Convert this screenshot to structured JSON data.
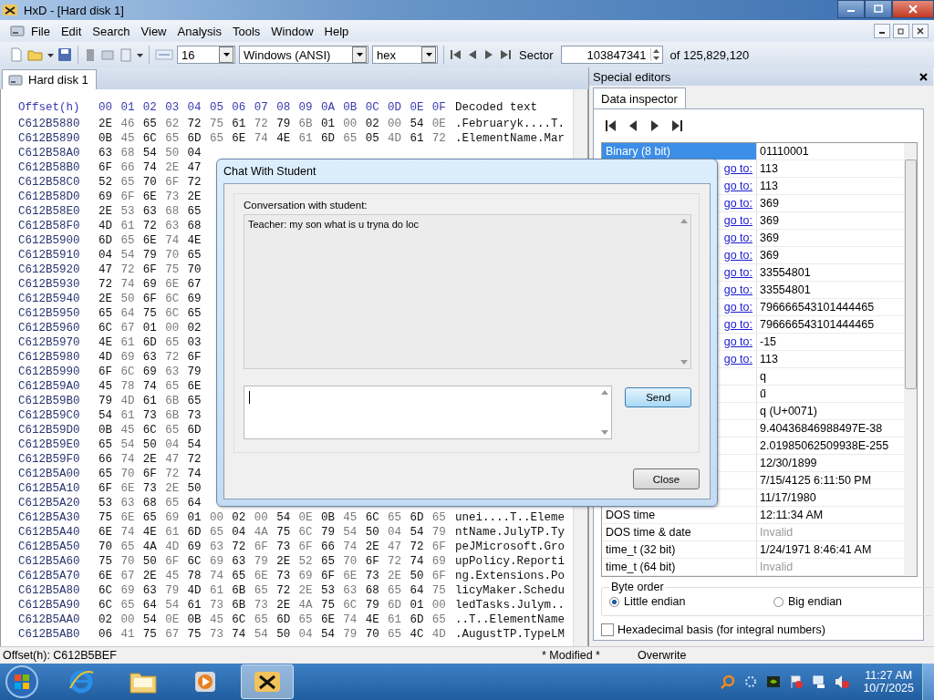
{
  "window": {
    "title": "HxD - [Hard disk 1]"
  },
  "menu": [
    "File",
    "Edit",
    "Search",
    "View",
    "Analysis",
    "Tools",
    "Window",
    "Help"
  ],
  "toolbar": {
    "bytes_per_row": "16",
    "charset": "Windows (ANSI)",
    "display": "hex",
    "sector_label": "Sector",
    "sector": "103847341",
    "sector_total": "of 125,829,120"
  },
  "document_tabs": [
    {
      "label": "Hard disk 1",
      "selected": true
    }
  ],
  "hex_view": {
    "header": {
      "offset": "Offset(h)",
      "columns": "00 01 02 03 04 05 06 07 08 09 0A 0B 0C 0D 0E 0F",
      "decoded": "Decoded text"
    },
    "rows": [
      {
        "offset": "C612B5880",
        "bytes": "2E 46 65 62 72 75 61 72 79 6B 01 00 02 00 54 0E",
        "text": ".Februaryk....T."
      },
      {
        "offset": "C612B5890",
        "bytes": "0B 45 6C 65 6D 65 6E 74 4E 61 6D 65 05 4D 61 72",
        "text": ".ElementName.Mar"
      },
      {
        "offset": "C612B58A0",
        "bytes": "63 68 54 50 04"
      },
      {
        "offset": "C612B58B0",
        "bytes": "6F 66 74 2E 47"
      },
      {
        "offset": "C612B58C0",
        "bytes": "52 65 70 6F 72"
      },
      {
        "offset": "C612B58D0",
        "bytes": "69 6F 6E 73 2E"
      },
      {
        "offset": "C612B58E0",
        "bytes": "2E 53 63 68 65"
      },
      {
        "offset": "C612B58F0",
        "bytes": "4D 61 72 63 68"
      },
      {
        "offset": "C612B5900",
        "bytes": "6D 65 6E 74 4E"
      },
      {
        "offset": "C612B5910",
        "bytes": "04 54 79 70 65"
      },
      {
        "offset": "C612B5920",
        "bytes": "47 72 6F 75 70"
      },
      {
        "offset": "C612B5930",
        "bytes": "72 74 69 6E 67"
      },
      {
        "offset": "C612B5940",
        "bytes": "2E 50 6F 6C 69"
      },
      {
        "offset": "C612B5950",
        "bytes": "65 64 75 6C 65"
      },
      {
        "offset": "C612B5960",
        "bytes": "6C 67 01 00 02"
      },
      {
        "offset": "C612B5970",
        "bytes": "4E 61 6D 65 03"
      },
      {
        "offset": "C612B5980",
        "bytes": "4D 69 63 72 6F"
      },
      {
        "offset": "C612B5990",
        "bytes": "6F 6C 69 63 79"
      },
      {
        "offset": "C612B59A0",
        "bytes": "45 78 74 65 6E"
      },
      {
        "offset": "C612B59B0",
        "bytes": "79 4D 61 6B 65"
      },
      {
        "offset": "C612B59C0",
        "bytes": "54 61 73 6B 73"
      },
      {
        "offset": "C612B59D0",
        "bytes": "0B 45 6C 65 6D"
      },
      {
        "offset": "C612B59E0",
        "bytes": "65 54 50 04 54"
      },
      {
        "offset": "C612B59F0",
        "bytes": "66 74 2E 47 72"
      },
      {
        "offset": "C612B5A00",
        "bytes": "65 70 6F 72 74"
      },
      {
        "offset": "C612B5A10",
        "bytes": "6F 6E 73 2E 50"
      },
      {
        "offset": "C612B5A20",
        "bytes": "53 63 68 65 64"
      },
      {
        "offset": "C612B5A30",
        "bytes": "75 6E 65 69 01 00 02 00 54 0E 0B 45 6C 65 6D 65",
        "text": "unei....T..Eleme"
      },
      {
        "offset": "C612B5A40",
        "bytes": "6E 74 4E 61 6D 65 04 4A 75 6C 79 54 50 04 54 79",
        "text": "ntName.JulyTP.Ty"
      },
      {
        "offset": "C612B5A50",
        "bytes": "70 65 4A 4D 69 63 72 6F 73 6F 66 74 2E 47 72 6F",
        "text": "peJMicrosoft.Gro"
      },
      {
        "offset": "C612B5A60",
        "bytes": "75 70 50 6F 6C 69 63 79 2E 52 65 70 6F 72 74 69",
        "text": "upPolicy.Reporti"
      },
      {
        "offset": "C612B5A70",
        "bytes": "6E 67 2E 45 78 74 65 6E 73 69 6F 6E 73 2E 50 6F",
        "text": "ng.Extensions.Po"
      },
      {
        "offset": "C612B5A80",
        "bytes": "6C 69 63 79 4D 61 6B 65 72 2E 53 63 68 65 64 75",
        "text": "licyMaker.Schedu"
      },
      {
        "offset": "C612B5A90",
        "bytes": "6C 65 64 54 61 73 6B 73 2E 4A 75 6C 79 6D 01 00",
        "text": "ledTasks.Julym.."
      },
      {
        "offset": "C612B5AA0",
        "bytes": "02 00 54 0E 0B 45 6C 65 6D 65 6E 74 4E 61 6D 65",
        "text": "..T..ElementName"
      },
      {
        "offset": "C612B5AB0",
        "bytes": "06 41 75 67 75 73 74 54 50 04 54 79 70 65 4C 4D",
        "text": ".AugustTP.TypeLM"
      }
    ]
  },
  "special_editors": {
    "title": "Special editors",
    "tabs": [
      {
        "label": "Data inspector",
        "selected": true
      }
    ],
    "rows": [
      {
        "label": "Binary (8 bit)",
        "value": "01110001",
        "selected": true,
        "invalid": false
      },
      {
        "link": "go to:",
        "value": "113",
        "selected": false,
        "invalid": false
      },
      {
        "link": "go to:",
        "value": "113",
        "selected": false,
        "invalid": false
      },
      {
        "link": "go to:",
        "value": "369",
        "selected": false,
        "invalid": false
      },
      {
        "link": "go to:",
        "value": "369",
        "selected": false,
        "invalid": false
      },
      {
        "link": "go to:",
        "value": "369",
        "selected": false,
        "invalid": false
      },
      {
        "link": "go to:",
        "value": "369",
        "selected": false,
        "invalid": false
      },
      {
        "link": "go to:",
        "value": "33554801",
        "selected": false,
        "invalid": false
      },
      {
        "link": "go to:",
        "value": "33554801",
        "selected": false,
        "invalid": false
      },
      {
        "link": "go to:",
        "value": "796666543101444465",
        "selected": false,
        "invalid": false
      },
      {
        "link": "go to:",
        "value": "796666543101444465",
        "selected": false,
        "invalid": false
      },
      {
        "link": "go to:",
        "value": "-15",
        "selected": false,
        "invalid": false
      },
      {
        "link": "go to:",
        "value": "113",
        "selected": false,
        "invalid": false
      },
      {
        "value": "q",
        "selected": false,
        "invalid": false
      },
      {
        "value": "ű",
        "selected": false,
        "invalid": false
      },
      {
        "value": "q (U+0071)",
        "selected": false,
        "invalid": false
      },
      {
        "value": "9.40436846988497E-38",
        "selected": false,
        "invalid": false
      },
      {
        "value": "2.01985062509938E-255",
        "selected": false,
        "invalid": false
      },
      {
        "value": "12/30/1899",
        "selected": false,
        "invalid": false
      },
      {
        "value": "7/15/4125 6:11:50 PM",
        "selected": false,
        "invalid": false
      },
      {
        "value": "11/17/1980",
        "selected": false,
        "invalid": false
      },
      {
        "label": "DOS time",
        "value": "12:11:34 AM",
        "selected": false,
        "invalid": false
      },
      {
        "label": "DOS time & date",
        "value": "Invalid",
        "selected": false,
        "invalid": true
      },
      {
        "label": "time_t (32 bit)",
        "value": "1/24/1971 8:46:41 AM",
        "selected": false,
        "invalid": false
      },
      {
        "label": "time_t (64 bit)",
        "value": "Invalid",
        "selected": false,
        "invalid": true
      }
    ],
    "byte_order": {
      "title": "Byte order",
      "options": [
        {
          "label": "Little endian",
          "selected": true
        },
        {
          "label": "Big endian",
          "selected": false
        }
      ]
    },
    "hex_basis": {
      "label": "Hexadecimal basis (for integral numbers)",
      "checked": false
    }
  },
  "dialog": {
    "title": "Chat With Student",
    "group": "Conversation with student:",
    "conversation": "Teacher: my son what is u tryna do loc",
    "buttons": [
      {
        "kind": "send",
        "label": "Send"
      },
      {
        "kind": "close",
        "label": "Close"
      }
    ]
  },
  "status_bar": [
    "Offset(h): C612B5BEF",
    "* Modified *",
    "Overwrite"
  ],
  "taskbar": {
    "apps": [
      {
        "kind": "browser",
        "selected": false
      },
      {
        "kind": "folder",
        "selected": false
      },
      {
        "kind": "player",
        "selected": false
      },
      {
        "kind": "hxd",
        "selected": true
      }
    ],
    "time": "11:27 AM",
    "date": "10/7/2025"
  }
}
